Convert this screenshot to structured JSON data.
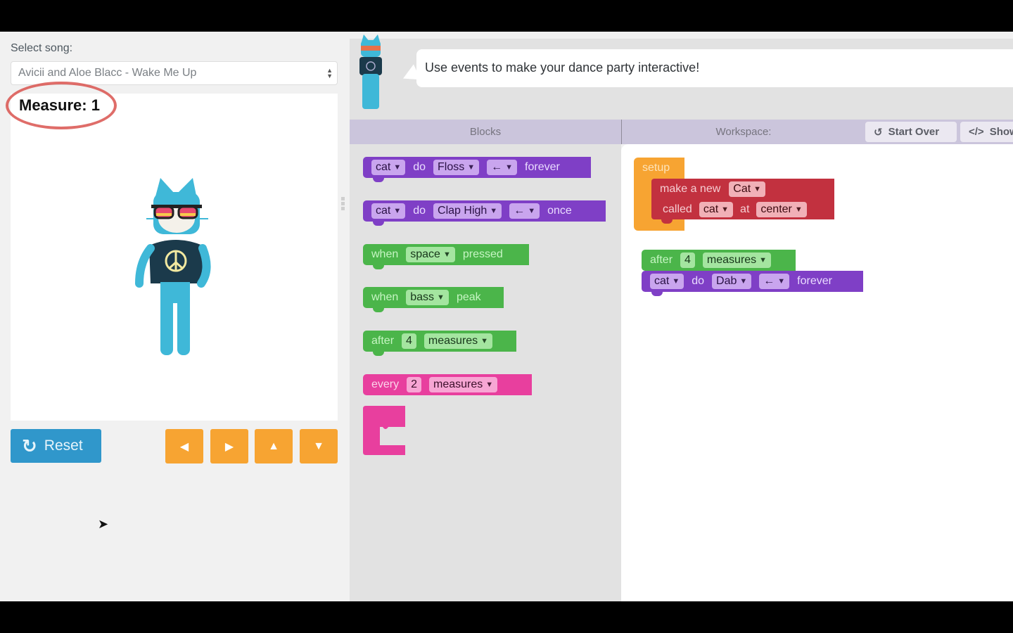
{
  "left_panel": {
    "song_label": "Select song:",
    "song_selected": "Avicii and Aloe Blacc - Wake Me Up",
    "measure_label": "Measure: 1",
    "reset_label": "Reset",
    "reset_icon": "refresh-icon",
    "arrow_buttons": [
      {
        "name": "left",
        "glyph": "◀"
      },
      {
        "name": "right",
        "glyph": "▶"
      },
      {
        "name": "up",
        "glyph": "▲"
      },
      {
        "name": "down",
        "glyph": "▼"
      }
    ]
  },
  "instructions": {
    "text": "Use events to make your dance party interactive!"
  },
  "header": {
    "blocks_label": "Blocks",
    "workspace_label": "Workspace:",
    "start_over_label": "Start Over",
    "start_over_icon": "↺",
    "show_code_label": "Show Code",
    "show_code_icon": "</>"
  },
  "toolbox": {
    "b1": {
      "sprite": "cat",
      "do": "do",
      "move": "Floss",
      "dir": "←",
      "mode": "forever"
    },
    "b2": {
      "sprite": "cat",
      "do": "do",
      "move": "Clap High",
      "dir": "←",
      "mode": "once"
    },
    "b3": {
      "when": "when",
      "key": "space",
      "suffix": "pressed"
    },
    "b4": {
      "when": "when",
      "range": "bass",
      "suffix": "peak"
    },
    "b5": {
      "after": "after",
      "n": "4",
      "unit": "measures"
    },
    "b6": {
      "every": "every",
      "n": "2",
      "unit": "measures"
    }
  },
  "workspace": {
    "setup": {
      "label": "setup"
    },
    "make": {
      "line1": "make a new",
      "type": "Cat",
      "called": "called",
      "name": "cat",
      "at": "at",
      "loc": "center"
    },
    "after": {
      "after": "after",
      "n": "4",
      "unit": "measures"
    },
    "dab": {
      "sprite": "cat",
      "do": "do",
      "move": "Dab",
      "dir": "←",
      "mode": "forever"
    }
  },
  "colors": {
    "reset": "#3097cb",
    "arrow": "#f7a432",
    "dance_block": "#7f3fc6",
    "event_block": "#4bb54a",
    "every_block": "#e83f9e",
    "sprite_block": "#c2313f",
    "setup_block": "#f7a432",
    "header": "#cbc5dc"
  }
}
